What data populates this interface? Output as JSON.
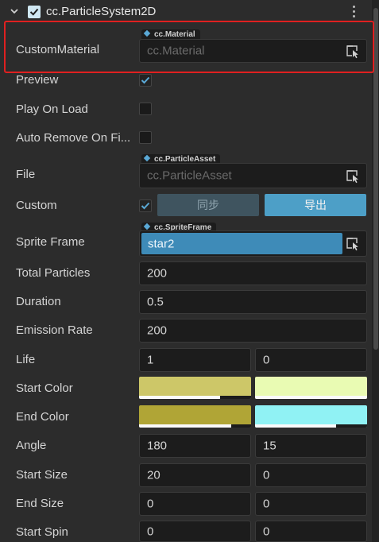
{
  "component": {
    "title": "cc.ParticleSystem2D",
    "enabled": true
  },
  "rows": {
    "custom_material": {
      "label": "CustomMaterial",
      "asset_type": "cc.Material",
      "placeholder": "cc.Material"
    },
    "preview": {
      "label": "Preview",
      "checked": true
    },
    "play_on_load": {
      "label": "Play On Load",
      "checked": false
    },
    "auto_remove": {
      "label": "Auto Remove On Fi...",
      "checked": false
    },
    "file": {
      "label": "File",
      "asset_type": "cc.ParticleAsset",
      "placeholder": "cc.ParticleAsset"
    },
    "custom": {
      "label": "Custom",
      "checked": true,
      "sync_label": "同步",
      "export_label": "导出"
    },
    "sprite_frame": {
      "label": "Sprite Frame",
      "asset_type": "cc.SpriteFrame",
      "value": "star2"
    },
    "total_particles": {
      "label": "Total Particles",
      "value": "200"
    },
    "duration": {
      "label": "Duration",
      "value": "0.5"
    },
    "emission_rate": {
      "label": "Emission Rate",
      "value": "200"
    },
    "life": {
      "label": "Life",
      "value": "1",
      "variance": "0"
    },
    "start_color": {
      "label": "Start Color",
      "color": "#cdc768",
      "color_var": "#e9fbb3",
      "alpha": 0.72,
      "alpha_var": 1.0
    },
    "end_color": {
      "label": "End Color",
      "color": "#b0a536",
      "color_var": "#90f2f4",
      "alpha": 0.82,
      "alpha_var": 0.72
    },
    "angle": {
      "label": "Angle",
      "value": "180",
      "variance": "15"
    },
    "start_size": {
      "label": "Start Size",
      "value": "20",
      "variance": "0"
    },
    "end_size": {
      "label": "End Size",
      "value": "0",
      "variance": "0"
    },
    "start_spin": {
      "label": "Start Spin",
      "value": "0",
      "variance": "0"
    }
  },
  "colors": {
    "accent": "#3e8bb8",
    "highlight_border": "#e02020"
  }
}
